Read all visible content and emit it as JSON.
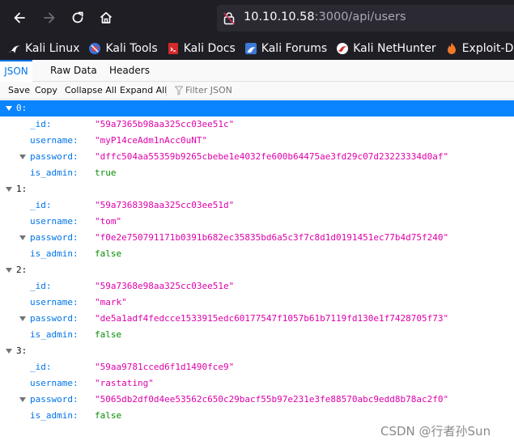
{
  "browser": {
    "url_host": "10.10.10.58",
    "url_path": ":3000/api/users"
  },
  "bookmarks": [
    {
      "label": "Kali Linux",
      "icon": "kali-dragon-icon"
    },
    {
      "label": "Kali Tools",
      "icon": "kali-tools-icon"
    },
    {
      "label": "Kali Docs",
      "icon": "kali-docs-icon"
    },
    {
      "label": "Kali Forums",
      "icon": "kali-forums-icon"
    },
    {
      "label": "Kali NetHunter",
      "icon": "kali-nethunter-icon"
    },
    {
      "label": "Exploit-DB",
      "icon": "exploit-db-icon"
    }
  ],
  "viewer_tabs": [
    "JSON",
    "Raw Data",
    "Headers"
  ],
  "toolbar": {
    "save": "Save",
    "copy": "Copy",
    "collapse_all": "Collapse All",
    "expand_all": "Expand All",
    "filter_placeholder": "Filter JSON"
  },
  "users": [
    {
      "index": "0:",
      "id": "\"59a7365b98aa325cc03ee51c\"",
      "username": "\"myP14ceAdm1nAcc0uNT\"",
      "password": "\"dffc504aa55359b9265cbebe1e4032fe600b64475ae3fd29c07d23223334d0af\"",
      "is_admin": "true"
    },
    {
      "index": "1:",
      "id": "\"59a7368398aa325cc03ee51d\"",
      "username": "\"tom\"",
      "password": "\"f0e2e750791171b0391b682ec35835bd6a5c3f7c8d1d0191451ec77b4d75f240\"",
      "is_admin": "false"
    },
    {
      "index": "2:",
      "id": "\"59a7368e98aa325cc03ee51e\"",
      "username": "\"mark\"",
      "password": "\"de5a1adf4fedcce1533915edc60177547f1057b61b7119fd130e1f7428705f73\"",
      "is_admin": "false"
    },
    {
      "index": "3:",
      "id": "\"59aa9781cced6f1d1490fce9\"",
      "username": "\"rastating\"",
      "password": "\"5065db2df0d4ee53562c650c29bacf55b97e231e3fe88570abc9edd8b78ac2f0\"",
      "is_admin": "false"
    }
  ],
  "keys": {
    "id": "_id:",
    "username": "username:",
    "password": "password:",
    "is_admin": "is_admin:"
  },
  "watermark": "CSDN @行者孙Sun",
  "colors": {
    "chrome_bg": "#1e1e24",
    "selection": "#0a84ff",
    "key": "#0074e8",
    "string": "#dd00a9",
    "boolean": "#058b00"
  }
}
